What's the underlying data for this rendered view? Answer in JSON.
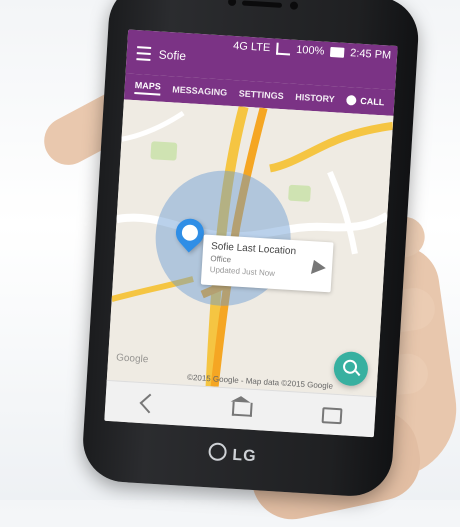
{
  "status": {
    "carrier_signal": "4G LTE",
    "battery": "100%",
    "time": "2:45 PM"
  },
  "appbar": {
    "title": "Sofie"
  },
  "tabs": [
    {
      "label": "MAPS",
      "active": true
    },
    {
      "label": "MESSAGING",
      "active": false
    },
    {
      "label": "SETTINGS",
      "active": false
    },
    {
      "label": "HISTORY",
      "active": false
    }
  ],
  "call": {
    "label": "CALL"
  },
  "map": {
    "card": {
      "title": "Sofie Last Location",
      "place": "Office",
      "updated": "Updated Just Now"
    },
    "credits": "©2015 Google - Map data ©2015 Google",
    "google": "Google"
  },
  "device": {
    "brand": "LG"
  },
  "colors": {
    "appbar": "#7b3385",
    "fab": "#37b0a0",
    "pin": "#2f8ee6"
  }
}
